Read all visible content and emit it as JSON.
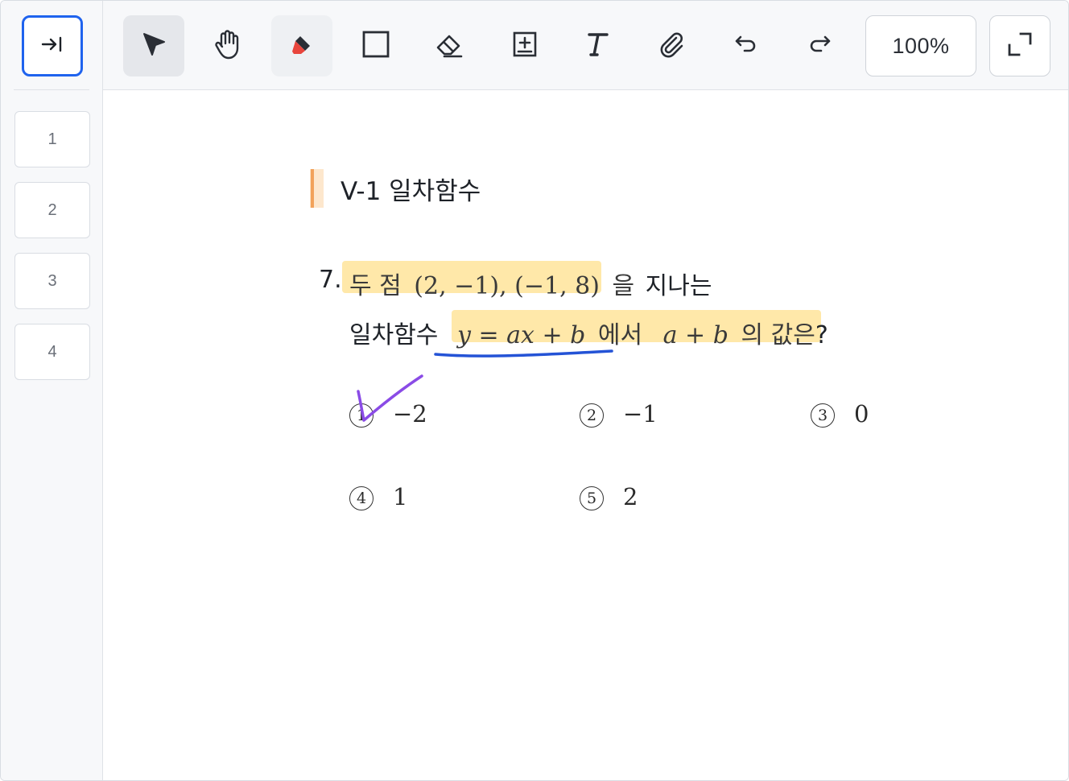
{
  "sidebar": {
    "collapse_icon": "collapse-sidebar-icon",
    "pages": [
      "1",
      "2",
      "3",
      "4"
    ]
  },
  "toolbar": {
    "tools": [
      "select-arrow-icon",
      "hand-icon",
      "highlighter-icon",
      "rectangle-icon",
      "eraser-icon",
      "add-box-icon",
      "text-icon",
      "paperclip-icon",
      "undo-icon",
      "redo-icon"
    ],
    "zoom": "100%",
    "fullscreen_icon": "fullscreen-icon",
    "accent": "#1f63ee",
    "highlighter_color": "#e8453c"
  },
  "document": {
    "section_title": "V-1 일차함수",
    "question": {
      "number": "7.",
      "line1_a": "두 점",
      "line1_points": "(2, −1), (−1, 8)",
      "line1_b": "을",
      "line1_c": "지나는",
      "line2_a": "일차함수",
      "line2_eq": "y = ax + b",
      "line2_b": "에서",
      "line2_expr": "a + b",
      "line2_c": "의 값은",
      "line2_d": "?"
    },
    "choices": [
      {
        "num": "1",
        "value": "−2"
      },
      {
        "num": "2",
        "value": "−1"
      },
      {
        "num": "3",
        "value": "0"
      },
      {
        "num": "4",
        "value": "1"
      },
      {
        "num": "5",
        "value": "2"
      }
    ],
    "annotations": {
      "highlight_color": "#ffd970",
      "underline_color": "#2453d6",
      "check_color": "#8a4be6"
    }
  }
}
